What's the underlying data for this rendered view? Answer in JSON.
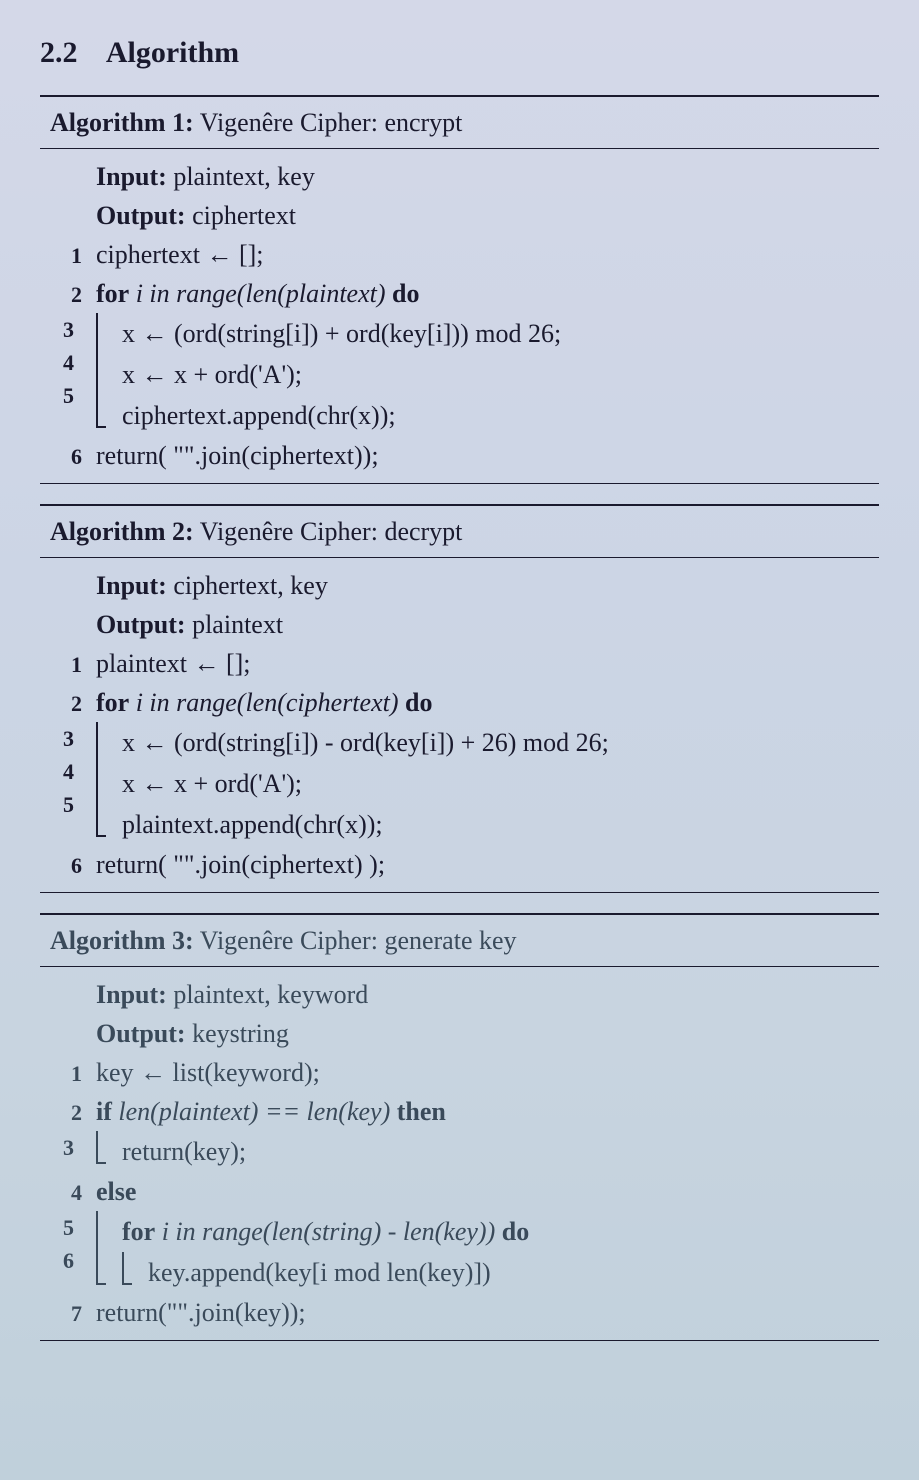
{
  "section": {
    "number": "2.2",
    "title": "Algorithm"
  },
  "algo1": {
    "header_label": "Algorithm 1:",
    "header_title": "Vigenêre Cipher: encrypt",
    "input_label": "Input:",
    "input_value": "plaintext, key",
    "output_label": "Output:",
    "output_value": "ciphertext",
    "l1": "ciphertext ← [];",
    "l2_for": "for",
    "l2_cond": "i in range(len(plaintext)",
    "l2_do": "do",
    "l3": "x ← (ord(string[i]) + ord(key[i])) mod 26;",
    "l4": "x ← x + ord('A');",
    "l5": "ciphertext.append(chr(x));",
    "l6": "return( \"\".join(ciphertext));"
  },
  "algo2": {
    "header_label": "Algorithm 2:",
    "header_title": "Vigenêre Cipher: decrypt",
    "input_label": "Input:",
    "input_value": "ciphertext, key",
    "output_label": "Output:",
    "output_value": "plaintext",
    "l1": "plaintext ← [];",
    "l2_for": "for",
    "l2_cond": "i in range(len(ciphertext)",
    "l2_do": "do",
    "l3": "x ← (ord(string[i]) - ord(key[i]) + 26) mod 26;",
    "l4": "x ← x + ord('A');",
    "l5": "plaintext.append(chr(x));",
    "l6": "return( \"\".join(ciphertext) );"
  },
  "algo3": {
    "header_label": "Algorithm 3:",
    "header_title": "Vigenêre Cipher: generate key",
    "input_label": "Input:",
    "input_value": "plaintext, keyword",
    "output_label": "Output:",
    "output_value": "keystring",
    "l1": "key ← list(keyword);",
    "l2_if": "if",
    "l2_cond": "len(plaintext) == len(key)",
    "l2_then": "then",
    "l3": "return(key);",
    "l4_else": "else",
    "l5_for": "for",
    "l5_cond": "i in range(len(string) - len(key))",
    "l5_do": "do",
    "l6": "key.append(key[i mod len(key)])",
    "l7": "return(\"\".join(key));"
  }
}
